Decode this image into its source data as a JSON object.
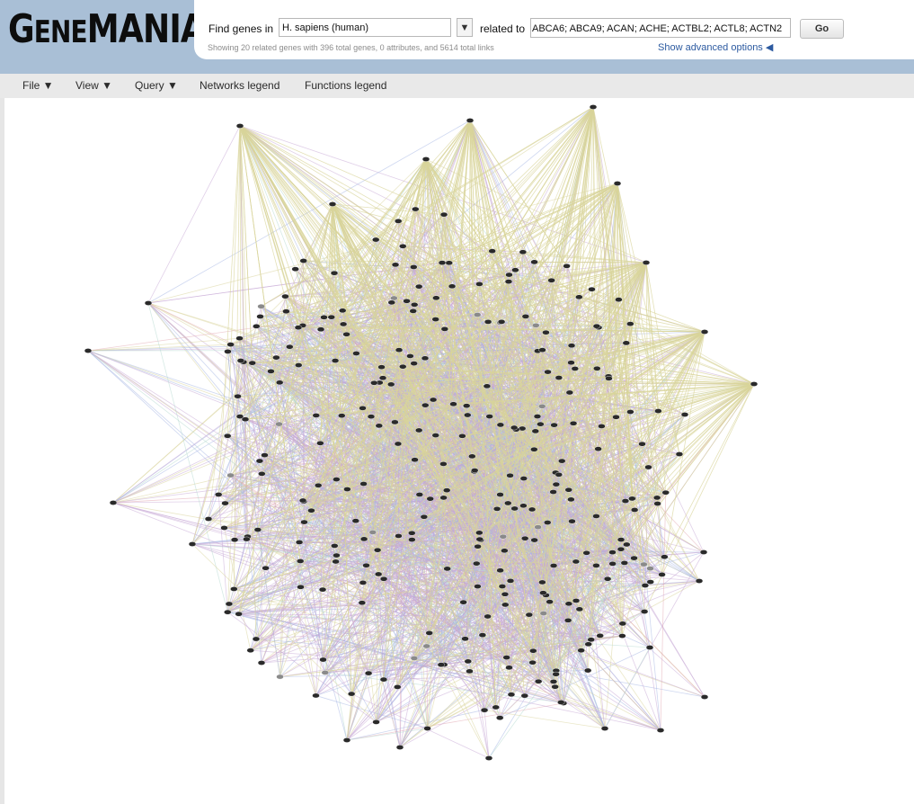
{
  "app": {
    "logo_big1": "G",
    "logo_small1": "ENE",
    "logo_big2": "MANIA"
  },
  "search": {
    "find_label": "Find genes in",
    "organism": "H. sapiens (human)",
    "organism_arrow": "▼",
    "related_label": "related to",
    "genes_value": "ABCA6; ABCA9; ACAN; ACHE; ACTBL2; ACTL8; ACTN2",
    "go_label": "Go",
    "summary": "Showing 20 related genes with 396 total genes, 0 attributes, and 5614 total links",
    "advanced_label": "Show advanced options ◀"
  },
  "menu": [
    {
      "label": "File ▼"
    },
    {
      "label": "View ▼"
    },
    {
      "label": "Query ▼"
    },
    {
      "label": "Networks legend"
    },
    {
      "label": "Functions legend"
    }
  ],
  "network": {
    "node_color": "#2a2a2a",
    "highlight_node_color": "#8a8a8a",
    "edge_colors": [
      "#d8d49a",
      "#c6a7d6",
      "#a6b7e3",
      "#b5d9cf",
      "#e1a7b3"
    ]
  }
}
